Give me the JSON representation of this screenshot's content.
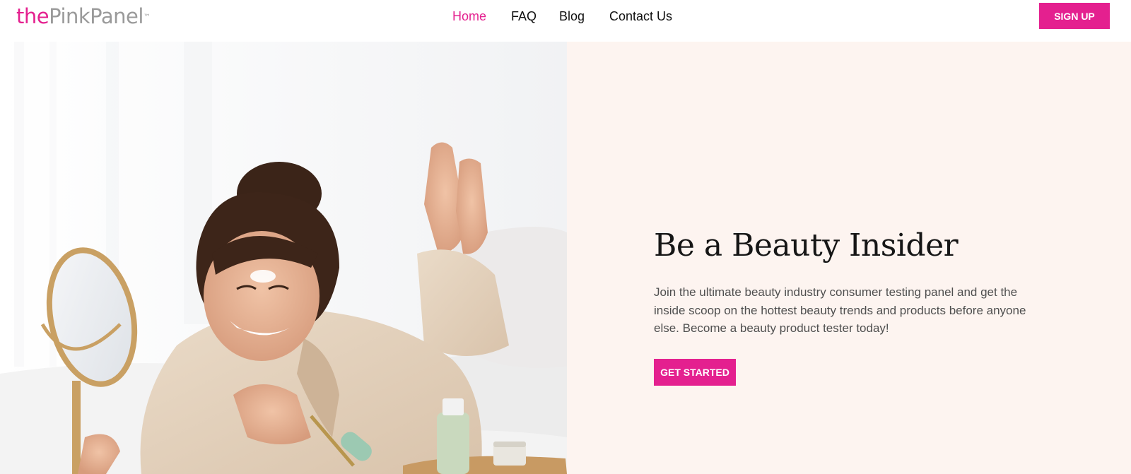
{
  "header": {
    "logo": {
      "prefix": "the",
      "name": "PinkPanel",
      "trademark": "™"
    },
    "nav": [
      {
        "label": "Home",
        "active": true
      },
      {
        "label": "FAQ",
        "active": false
      },
      {
        "label": "Blog",
        "active": false
      },
      {
        "label": "Contact Us",
        "active": false
      }
    ],
    "signup_label": "SIGN UP"
  },
  "hero": {
    "image_alt": "Woman in pajamas lying on a bed smiling at a round mirror while using a jade face roller, with skincare bottles on a wooden tray",
    "title": "Be a Beauty Insider",
    "body": "Join the ultimate beauty industry consumer testing panel and get the inside scoop on the hottest beauty trends and products before anyone else. Become a beauty product tester today!",
    "cta_label": "GET STARTED"
  },
  "colors": {
    "brand_pink": "#e4208f",
    "hero_background": "#fdf4f0",
    "text_dark": "#161616",
    "text_body": "#4f4f4f"
  }
}
